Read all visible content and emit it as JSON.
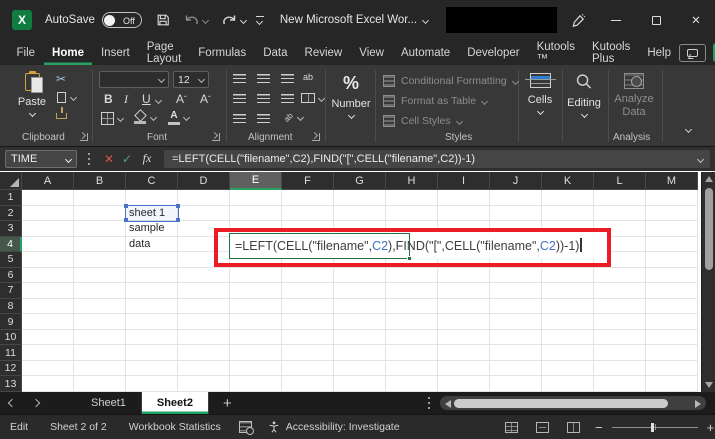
{
  "titlebar": {
    "app": "Excel",
    "autosave_label": "AutoSave",
    "autosave_state": "Off",
    "title": "New Microsoft Excel Wor..."
  },
  "ribbon_tabs": {
    "items": [
      "File",
      "Home",
      "Insert",
      "Page Layout",
      "Formulas",
      "Data",
      "Review",
      "View",
      "Automate",
      "Developer",
      "Kutools ™",
      "Kutools Plus",
      "Help"
    ],
    "active": "Home"
  },
  "ribbon": {
    "clipboard": {
      "paste_label": "Paste",
      "label": "Clipboard"
    },
    "font": {
      "size_value": "12",
      "bold": "B",
      "italic": "I",
      "underline": "U",
      "label": "Font"
    },
    "alignment": {
      "label": "Alignment"
    },
    "number": {
      "symbol": "%",
      "label": "Number"
    },
    "styles": {
      "items": [
        "Conditional Formatting",
        "Format as Table",
        "Cell Styles"
      ],
      "label": "Styles"
    },
    "cells": {
      "label": "Cells"
    },
    "editing": {
      "label": "Editing"
    },
    "analysis": {
      "button_label": "Analyze Data",
      "label": "Analysis"
    }
  },
  "formula_bar": {
    "name_box": "TIME",
    "fx": "fx",
    "formula": "=LEFT(CELL(\"filename\",C2),FIND(\"[\",CELL(\"filename\",C2))-1)"
  },
  "grid": {
    "columns": [
      "A",
      "B",
      "C",
      "D",
      "E",
      "F",
      "G",
      "H",
      "I",
      "J",
      "K",
      "L",
      "M"
    ],
    "rows": [
      "1",
      "2",
      "3",
      "4",
      "5",
      "6",
      "7",
      "8",
      "9",
      "10",
      "11",
      "12",
      "13"
    ],
    "selected_column": "E",
    "selected_row": "4",
    "cells": [
      {
        "ref": "C2",
        "text": "sheet 1",
        "highlighted": true
      },
      {
        "ref": "C3",
        "text": "sample",
        "highlighted": false
      },
      {
        "ref": "C4",
        "text": "data",
        "highlighted": false
      }
    ],
    "editing_cell": {
      "ref": "E4",
      "segments": [
        {
          "text": "=LEFT(CELL(\"filename\",",
          "color": "#3d3d3d"
        },
        {
          "text": "C2",
          "color": "#4472c4"
        },
        {
          "text": "),FIND(\"[\",CELL(\"filename\",",
          "color": "#3d3d3d"
        },
        {
          "text": "C2",
          "color": "#4472c4"
        },
        {
          "text": "))-1)",
          "color": "#3d3d3d"
        }
      ]
    }
  },
  "sheet_tabs": {
    "items": [
      "Sheet1",
      "Sheet2"
    ],
    "active": "Sheet2",
    "add_label": "+"
  },
  "status_bar": {
    "mode": "Edit",
    "sheet_info": "Sheet 2 of 2",
    "statistics_label": "Workbook Statistics",
    "accessibility_label": "Accessibility: Investigate"
  },
  "colors": {
    "excel_green": "#107C41",
    "share_green": "#21A366",
    "annotation_red": "#EC1C24",
    "reference_blue": "#4472C4",
    "active_underline_green": "#27A263"
  }
}
